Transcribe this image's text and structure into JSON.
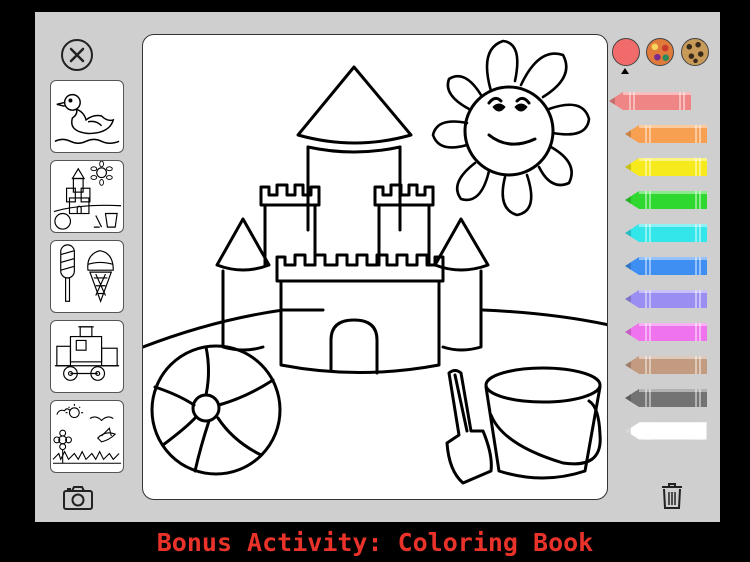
{
  "caption": "Bonus Activity: Coloring Book",
  "toolbar": {
    "close_icon": "close-icon",
    "camera_icon": "camera-icon",
    "trash_icon": "trash-icon"
  },
  "thumbnails": [
    {
      "name": "duck",
      "icon": "duck-picture"
    },
    {
      "name": "sandcastle",
      "icon": "sandcastle-picture",
      "selected": true
    },
    {
      "name": "ice-cream",
      "icon": "ice-cream-picture"
    },
    {
      "name": "train",
      "icon": "train-picture"
    },
    {
      "name": "garden",
      "icon": "garden-picture"
    }
  ],
  "swatches": [
    {
      "name": "solid-coral",
      "color": "#f26b6b",
      "selected": true
    },
    {
      "name": "pattern-dots",
      "color": "#c9584a"
    },
    {
      "name": "pattern-leopard",
      "color": "#b8864a"
    }
  ],
  "crayons": [
    {
      "name": "salmon",
      "color": "#f08585"
    },
    {
      "name": "orange",
      "color": "#f7a051"
    },
    {
      "name": "yellow",
      "color": "#f7ea1c"
    },
    {
      "name": "green",
      "color": "#2fd82f"
    },
    {
      "name": "cyan",
      "color": "#33e6ea"
    },
    {
      "name": "blue",
      "color": "#3f8ff2"
    },
    {
      "name": "purple",
      "color": "#9b8ef2"
    },
    {
      "name": "magenta",
      "color": "#f073ee"
    },
    {
      "name": "tan",
      "color": "#c29b80"
    },
    {
      "name": "gray",
      "color": "#737373"
    },
    {
      "name": "white",
      "color": "#ffffff"
    }
  ]
}
